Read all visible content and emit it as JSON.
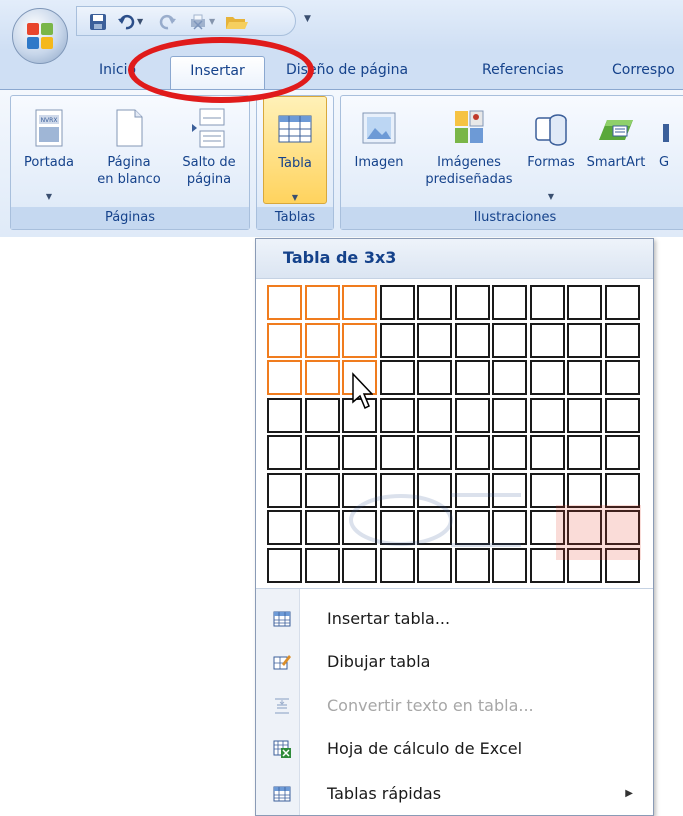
{
  "quick_access": {
    "icons": [
      "save-icon",
      "undo-icon",
      "redo-icon",
      "print-icon",
      "open-folder-icon",
      "customize-arrow-icon"
    ]
  },
  "tabs": [
    {
      "label": "Inicio"
    },
    {
      "label": "Insertar",
      "active": true
    },
    {
      "label": "Diseño de página"
    },
    {
      "label": "Referencias"
    },
    {
      "label": "Correspo"
    }
  ],
  "ribbon": {
    "groups": [
      {
        "label": "Páginas",
        "buttons": [
          {
            "label": "Portada",
            "dropdown": true,
            "icon": "cover-page-icon"
          },
          {
            "label": "Página\nen blanco",
            "icon": "blank-page-icon"
          },
          {
            "label": "Salto de\npágina",
            "icon": "page-break-icon"
          }
        ]
      },
      {
        "label": "Tablas",
        "buttons": [
          {
            "label": "Tabla",
            "dropdown": true,
            "icon": "table-icon",
            "pressed": true
          }
        ]
      },
      {
        "label": "Ilustraciones",
        "buttons": [
          {
            "label": "Imagen",
            "icon": "picture-icon"
          },
          {
            "label": "Imágenes\nprediseñadas",
            "icon": "clip-art-icon"
          },
          {
            "label": "Formas",
            "dropdown": true,
            "icon": "shapes-icon"
          },
          {
            "label": "SmartArt",
            "icon": "smartart-icon"
          },
          {
            "label": "G",
            "icon": "chart-icon"
          }
        ]
      }
    ]
  },
  "dropdown": {
    "title": "Tabla de 3x3",
    "grid": {
      "columns": 10,
      "rows": 8,
      "selected_columns": 3,
      "selected_rows": 3
    },
    "menu_items": [
      {
        "label": "Insertar tabla...",
        "icon": "insert-table-icon",
        "enabled": true
      },
      {
        "label": "Dibujar tabla",
        "icon": "draw-table-icon",
        "enabled": true
      },
      {
        "label": "Convertir texto en tabla...",
        "icon": "convert-text-icon",
        "enabled": false
      },
      {
        "label": "Hoja de cálculo de Excel",
        "icon": "excel-sheet-icon",
        "enabled": true
      },
      {
        "label": "Tablas rápidas",
        "icon": "quick-tables-icon",
        "enabled": true,
        "submenu": true
      }
    ]
  },
  "colors": {
    "highlight_ellipse": "#e01b1b",
    "selected_cell_border": "#f07c1e",
    "ribbon_text": "#15428b"
  }
}
